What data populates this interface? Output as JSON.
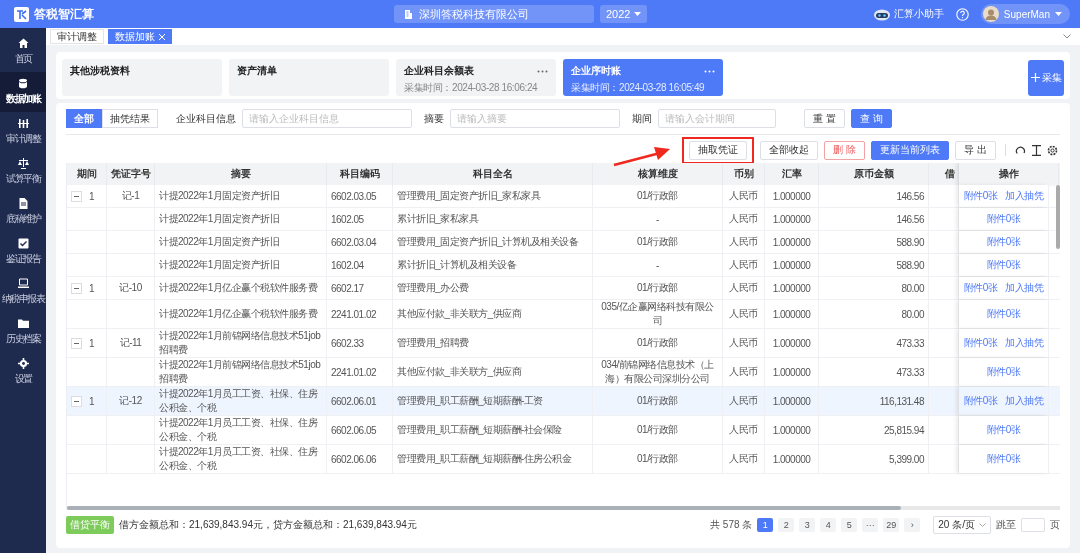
{
  "app": {
    "title": "答税智汇算",
    "company": "深圳答税科技有限公司",
    "year": "2022",
    "assistant": "汇算小助手",
    "user": "SuperMan"
  },
  "sidebar": {
    "items": [
      {
        "label": "首页",
        "selected": false
      },
      {
        "label": "数据加账",
        "selected": true
      },
      {
        "label": "审计调整",
        "selected": false
      },
      {
        "label": "试算平衡",
        "selected": false
      },
      {
        "label": "底稿维护",
        "selected": false
      },
      {
        "label": "鉴证报告",
        "selected": false
      },
      {
        "label": "纳税申报表",
        "selected": false
      },
      {
        "label": "历史档案",
        "selected": false
      },
      {
        "label": "设置",
        "selected": false
      }
    ]
  },
  "tabs": [
    {
      "label": "审计调整",
      "selected": false,
      "closable": false
    },
    {
      "label": "数据加账",
      "selected": true,
      "closable": true
    }
  ],
  "sources": [
    {
      "title": "其他涉税资料",
      "selected": false
    },
    {
      "title": "资产清单",
      "selected": false
    },
    {
      "title": "企业科目余额表",
      "time": "采集时间：2024-03-28 16:06:24",
      "selected": false
    },
    {
      "title": "企业序时账",
      "time": "采集时间：2024-03-28 16:05:49",
      "selected": true
    }
  ],
  "collect_button": "采集",
  "filter": {
    "modes": [
      {
        "label": "全部",
        "selected": true
      },
      {
        "label": "抽凭结果",
        "selected": false
      }
    ],
    "fields": [
      {
        "label": "企业科目信息",
        "placeholder": "请输入企业科目信息"
      },
      {
        "label": "摘要",
        "placeholder": "请输入摘要"
      },
      {
        "label": "期间",
        "placeholder": "请输入会计期间"
      }
    ],
    "buttons": [
      {
        "label": "重 置",
        "kind": "default"
      },
      {
        "label": "查 询",
        "kind": "primary"
      }
    ]
  },
  "toolbar": [
    {
      "label": "抽取凭证",
      "kind": "default",
      "highlighted": true
    },
    {
      "label": "全部收起",
      "kind": "default",
      "highlighted": false
    },
    {
      "label": "删 除",
      "kind": "danger",
      "highlighted": false
    },
    {
      "label": "更新当前列表",
      "kind": "primary",
      "highlighted": false
    },
    {
      "label": "导 出",
      "kind": "default",
      "highlighted": false
    }
  ],
  "table": {
    "columns": [
      "期间",
      "凭证字号",
      "摘要",
      "科目编码",
      "科目全名",
      "核算维度",
      "币别",
      "汇率",
      "原币金额",
      "借",
      "操作"
    ],
    "rows": [
      {
        "expanded": true,
        "period": "1",
        "voucher": "记-1",
        "summary": "计提2022年1月固定资产折旧",
        "code": "6602.03.05",
        "account": "管理费用_固定资产折旧_家私家具",
        "dimension": "01/行政部",
        "currency": "人民币",
        "rate": "1.000000",
        "amount": "146.56",
        "actions": [
          "附件0张",
          "加入抽凭"
        ],
        "selected": false
      },
      {
        "summary": "计提2022年1月固定资产折旧",
        "code": "1602.05",
        "account": "累计折旧_家私家具",
        "dimension": "-",
        "currency": "人民币",
        "rate": "1.000000",
        "amount": "146.56",
        "actions": [
          "附件0张"
        ],
        "selected": false
      },
      {
        "summary": "计提2022年1月固定资产折旧",
        "code": "6602.03.04",
        "account": "管理费用_固定资产折旧_计算机及相关设备",
        "dimension": "01/行政部",
        "currency": "人民币",
        "rate": "1.000000",
        "amount": "588.90",
        "actions": [
          "附件0张"
        ],
        "selected": false
      },
      {
        "summary": "计提2022年1月固定资产折旧",
        "code": "1602.04",
        "account": "累计折旧_计算机及相关设备",
        "dimension": "-",
        "currency": "人民币",
        "rate": "1.000000",
        "amount": "588.90",
        "actions": [
          "附件0张"
        ],
        "selected": false
      },
      {
        "expanded": true,
        "period": "1",
        "voucher": "记-10",
        "summary": "计提2022年1月亿企赢个税软件服务费",
        "code": "6602.17",
        "account": "管理费用_办公费",
        "dimension": "01/行政部",
        "currency": "人民币",
        "rate": "1.000000",
        "amount": "80.00",
        "actions": [
          "附件0张",
          "加入抽凭"
        ],
        "selected": false
      },
      {
        "summary": "计提2022年1月亿企赢个税软件服务费",
        "code": "2241.01.02",
        "account": "其他应付款_非关联方_供应商",
        "dimension": "035/亿企赢网络科技有限公司",
        "currency": "人民币",
        "rate": "1.000000",
        "amount": "80.00",
        "actions": [
          "附件0张"
        ],
        "selected": false
      },
      {
        "expanded": true,
        "period": "1",
        "voucher": "记-11",
        "summary": "计提2022年1月前锦网络信息技术51job招聘费",
        "code": "6602.33",
        "account": "管理费用_招聘费",
        "dimension": "01/行政部",
        "currency": "人民币",
        "rate": "1.000000",
        "amount": "473.33",
        "actions": [
          "附件0张",
          "加入抽凭"
        ],
        "selected": false
      },
      {
        "summary": "计提2022年1月前锦网络信息技术51job招聘费",
        "code": "2241.01.02",
        "account": "其他应付款_非关联方_供应商",
        "dimension": "034/前锦网络信息技术（上海）有限公司深圳分公司",
        "currency": "人民币",
        "rate": "1.000000",
        "amount": "473.33",
        "actions": [
          "附件0张"
        ],
        "selected": false
      },
      {
        "expanded": true,
        "period": "1",
        "voucher": "记-12",
        "summary": "计提2022年1月员工工资、社保、住房公积金、个税",
        "code": "6602.06.01",
        "account": "管理费用_职工薪酬_短期薪酬-工资",
        "dimension": "01/行政部",
        "currency": "人民币",
        "rate": "1.000000",
        "amount": "116,131.48",
        "actions": [
          "附件0张",
          "加入抽凭"
        ],
        "selected": true
      },
      {
        "summary": "计提2022年1月员工工资、社保、住房公积金、个税",
        "code": "6602.06.05",
        "account": "管理费用_职工薪酬_短期薪酬-社会保险",
        "dimension": "01/行政部",
        "currency": "人民币",
        "rate": "1.000000",
        "amount": "25,815.94",
        "actions": [
          "附件0张"
        ],
        "selected": false
      },
      {
        "summary": "计提2022年1月员工工资、社保、住房公积金、个税",
        "code": "6602.06.06",
        "account": "管理费用_职工薪酬_短期薪酬-住房公积金",
        "dimension": "01/行政部",
        "currency": "人民币",
        "rate": "1.000000",
        "amount": "5,399.00",
        "actions": [
          "附件0张"
        ],
        "selected": false
      }
    ]
  },
  "footer": {
    "badge": "借贷平衡",
    "totals": "借方金额总和：21,639,843.94元，贷方金额总和：21,639,843.94元"
  },
  "pagination": {
    "total": "共 578 条",
    "pages": [
      {
        "label": "1",
        "selected": true
      },
      {
        "label": "2",
        "selected": false
      },
      {
        "label": "3",
        "selected": false
      },
      {
        "label": "4",
        "selected": false
      },
      {
        "label": "5",
        "selected": false
      },
      {
        "label": "···",
        "selected": false
      },
      {
        "label": "29",
        "selected": false
      }
    ],
    "next": "›",
    "page_size": "20 条/页",
    "jump_label": "跳至",
    "jump_unit": "页"
  }
}
